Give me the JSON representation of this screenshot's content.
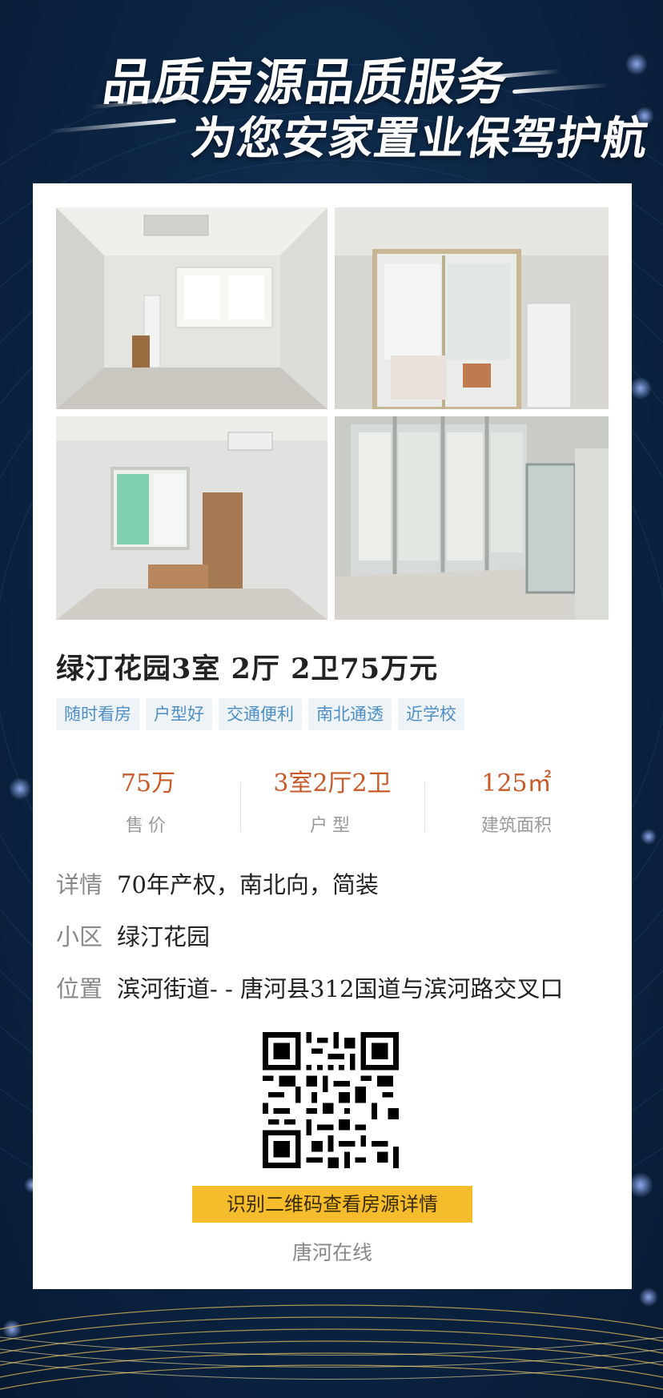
{
  "headline": {
    "line1": "品质房源品质服务",
    "line2": "为您安家置业保驾护航"
  },
  "listing": {
    "title": "绿汀花园3室 2厅 2卫75万元",
    "tags": [
      "随时看房",
      "户型好",
      "交通便利",
      "南北通透",
      "近学校"
    ],
    "stats": [
      {
        "value": "75万",
        "label": "售价"
      },
      {
        "value": "3室2厅2卫",
        "label": "户型"
      },
      {
        "value": "125㎡",
        "label": "建筑面积"
      }
    ],
    "details": {
      "label": "详情",
      "value": "70年产权，南北向，简装"
    },
    "community": {
      "label": "小区",
      "value": "绿汀花园"
    },
    "location": {
      "label": "位置",
      "value": "滨河街道- - 唐河县312国道与滨河路交叉口"
    }
  },
  "qr": {
    "cta_label": "识别二维码查看房源详情",
    "brand": "唐河在线"
  },
  "colors": {
    "background": "#0d2746",
    "price": "#c85a2a",
    "tag_text": "#4d8fc4",
    "tag_bg": "#eef3f8",
    "cta_bg": "#f5bd2b"
  },
  "icons": [
    "qr-code-icon"
  ]
}
